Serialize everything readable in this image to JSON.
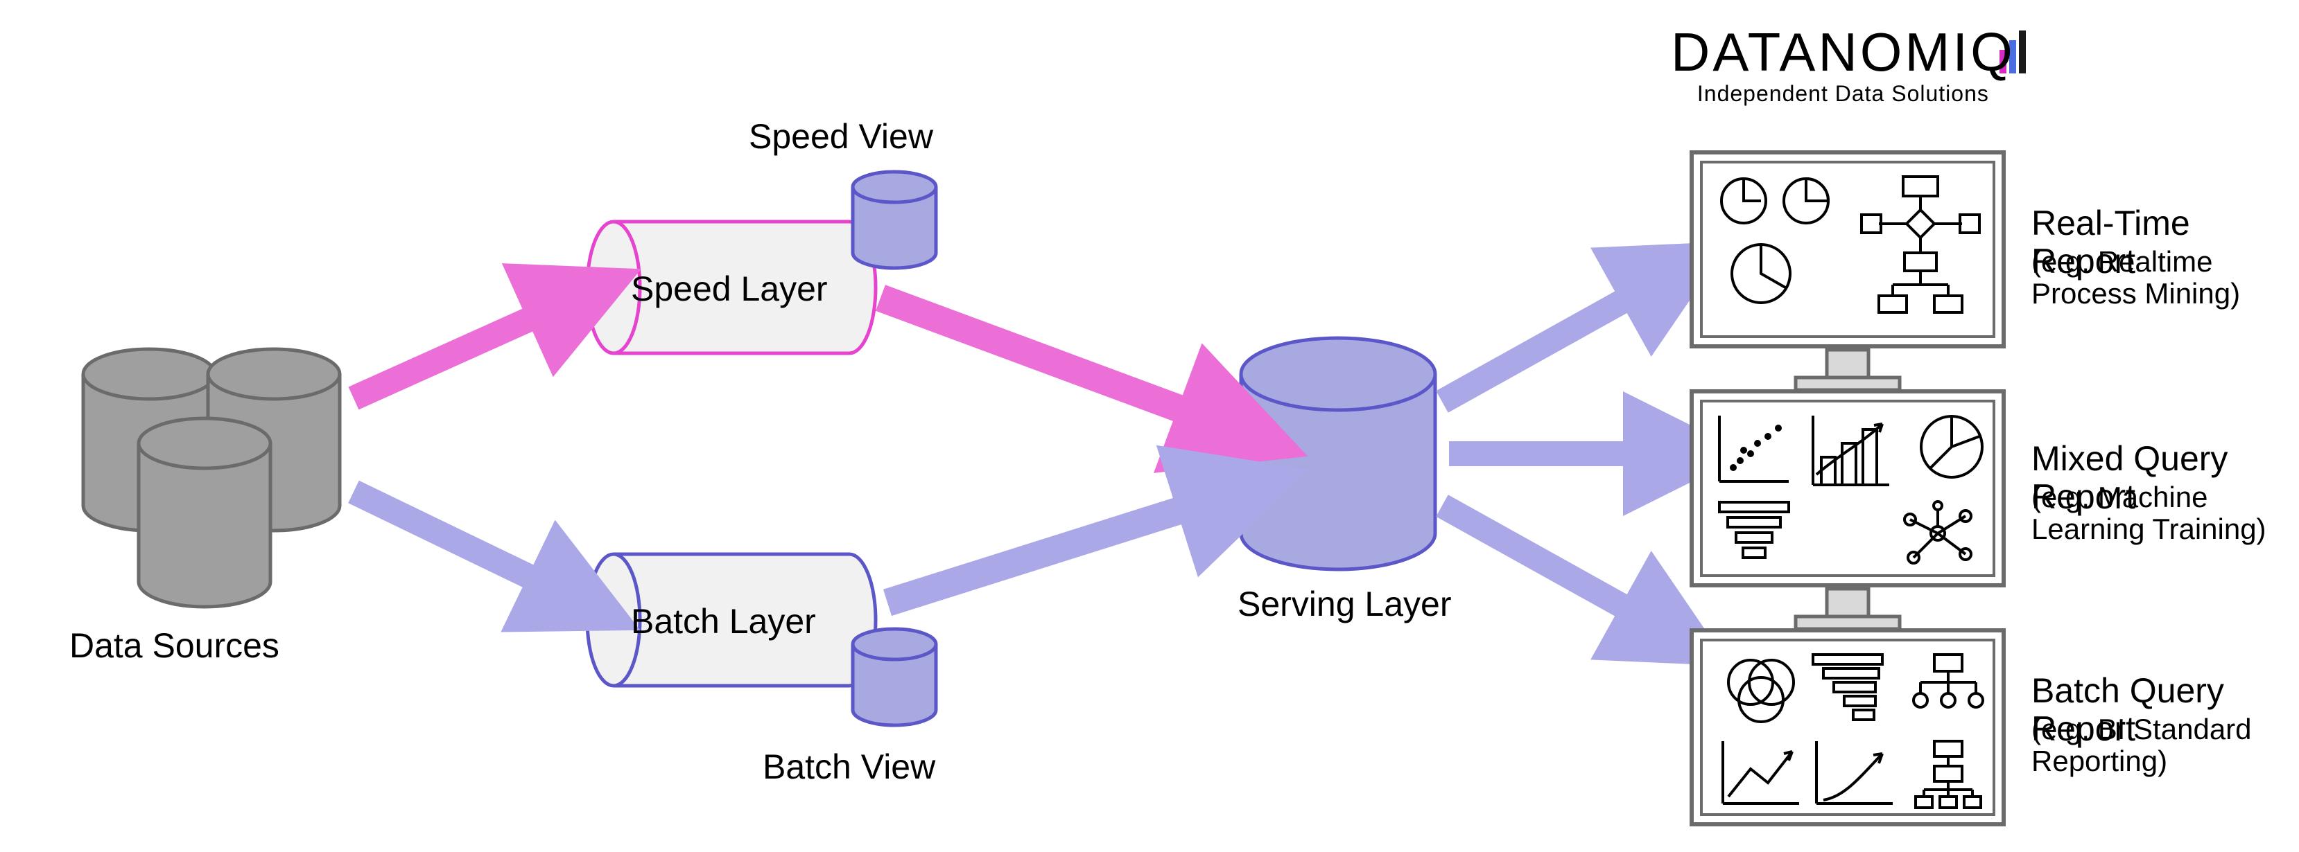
{
  "brand": {
    "name": "DATANOMIQ",
    "tagline": "Independent Data Solutions"
  },
  "nodes": {
    "data_sources": "Data Sources",
    "speed_layer": "Speed Layer",
    "speed_view": "Speed View",
    "batch_layer": "Batch Layer",
    "batch_view": "Batch View",
    "serving_layer": "Serving Layer"
  },
  "outputs": {
    "realtime": {
      "title": "Real-Time Report",
      "subtitle": "(e.g. Realtime Process Mining)"
    },
    "mixed": {
      "title": "Mixed Query Report",
      "subtitle": "(e.g. Machine Learning Training)"
    },
    "batch": {
      "title": "Batch Query Report",
      "subtitle": "(e.g. BI Standard Reporting)"
    }
  },
  "colors": {
    "gray_fill": "#9f9f9f",
    "gray_stroke": "#6b6b6b",
    "pipe_fill": "#f1f1f1",
    "pink": "#e643cf",
    "pink_arrow": "#ec6ed7",
    "blue_ind": "#5c57c9",
    "blue_fill": "#a8a9e0",
    "blue_arrow": "#aba8e8",
    "text": "#000000"
  }
}
